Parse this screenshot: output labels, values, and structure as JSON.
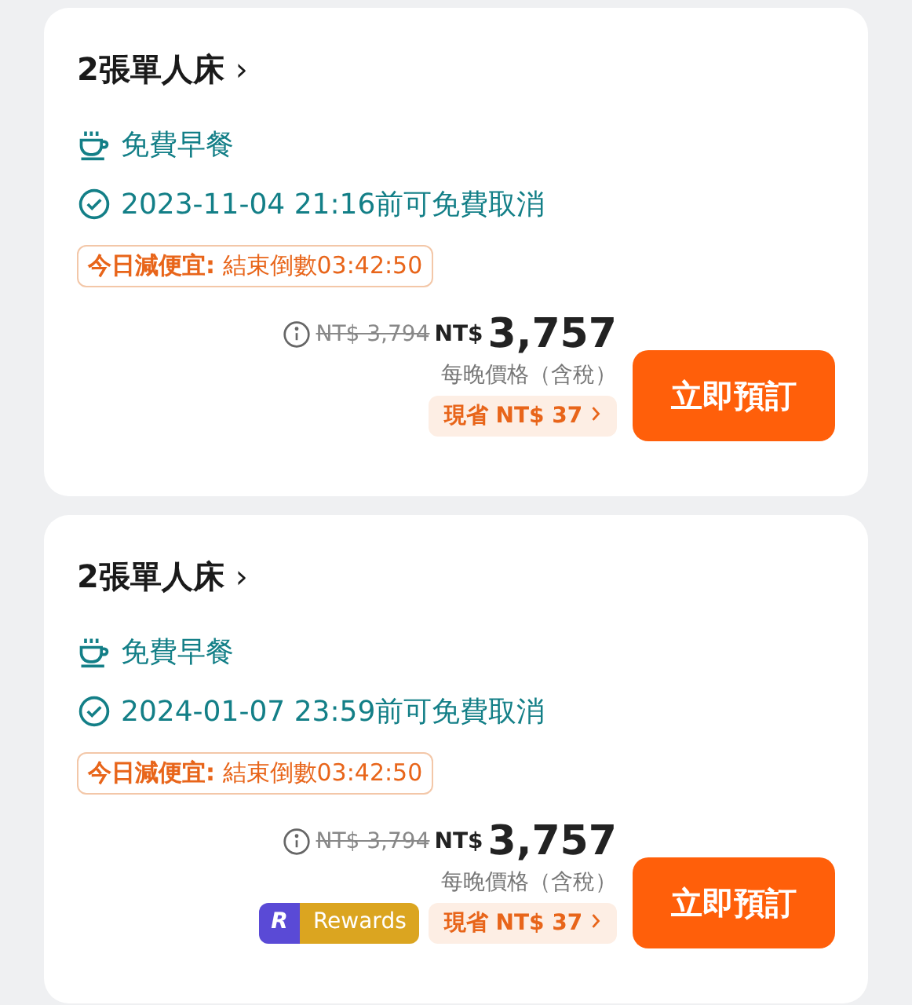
{
  "rooms": [
    {
      "title": "2張單人床",
      "chevron": "›",
      "breakfast": "免費早餐",
      "cancellation": "2023-11-04 21:16前可免費取消",
      "deal": {
        "label": "今日減便宜:",
        "countdown": "結束倒數03:42:50"
      },
      "original_price": "NT$ 3,794",
      "currency": "NT$",
      "price": "3,757",
      "price_note": "每晚價格（含稅）",
      "savings": "現省 NT$ 37",
      "book_button": "立即預訂"
    },
    {
      "title": "2張單人床",
      "chevron": "›",
      "breakfast": "免費早餐",
      "cancellation": "2024-01-07 23:59前可免費取消",
      "deal": {
        "label": "今日減便宜:",
        "countdown": "結束倒數03:42:50"
      },
      "original_price": "NT$ 3,794",
      "currency": "NT$",
      "price": "3,757",
      "price_note": "每晚價格（含稅）",
      "savings": "現省 NT$ 37",
      "rewards": {
        "logo": "R",
        "label": "Rewards"
      },
      "book_button": "立即預訂"
    }
  ]
}
